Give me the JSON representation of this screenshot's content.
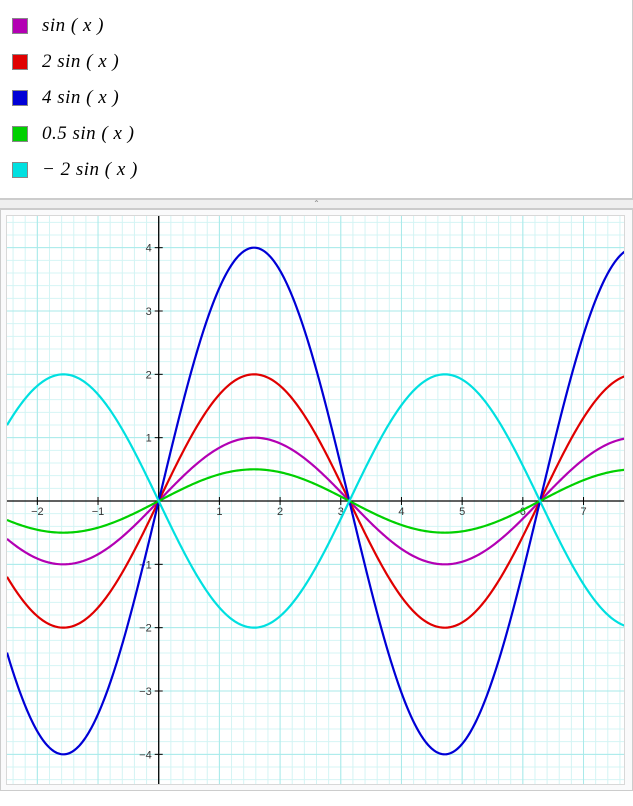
{
  "legend": {
    "items": [
      {
        "color": "#b300b3",
        "label": "sin ( x )"
      },
      {
        "color": "#e00000",
        "label": "2 sin ( x )"
      },
      {
        "color": "#0000d6",
        "label": "4 sin ( x )"
      },
      {
        "color": "#00d000",
        "label": "0.5 sin ( x )"
      },
      {
        "color": "#00e0e0",
        "label": "− 2 sin ( x )"
      }
    ]
  },
  "chart_data": {
    "type": "line",
    "xlabel": "",
    "ylabel": "",
    "title": "",
    "xlim": [
      -2.5,
      7.7
    ],
    "ylim": [
      -4.5,
      4.5
    ],
    "x_ticks": [
      -2,
      -1,
      1,
      2,
      3,
      4,
      5,
      6,
      7
    ],
    "y_ticks": [
      -4,
      -3,
      -2,
      -1,
      1,
      2,
      3,
      4
    ],
    "grid_minor": 0.2,
    "grid_major": 1,
    "series": [
      {
        "name": "sin(x)",
        "color": "#b300b3",
        "amplitude": 1,
        "fn": "sin"
      },
      {
        "name": "2 sin(x)",
        "color": "#e00000",
        "amplitude": 2,
        "fn": "sin"
      },
      {
        "name": "4 sin(x)",
        "color": "#0000d6",
        "amplitude": 4,
        "fn": "sin"
      },
      {
        "name": "0.5 sin(x)",
        "color": "#00d000",
        "amplitude": 0.5,
        "fn": "sin"
      },
      {
        "name": "-2 sin(x)",
        "color": "#00e0e0",
        "amplitude": -2,
        "fn": "sin"
      }
    ],
    "sample_points": {
      "x": [
        -2.5,
        -2,
        -1.5708,
        -1,
        0,
        1,
        1.5708,
        2,
        3,
        3.1416,
        4,
        4.7124,
        5,
        6,
        6.2832,
        7,
        7.7
      ],
      "sin(x)": [
        -0.5985,
        -0.9093,
        -1,
        -0.8415,
        0,
        0.8415,
        1,
        0.9093,
        0.1411,
        0,
        -0.7568,
        -1,
        -0.9589,
        -0.2794,
        0,
        0.657,
        0.9883
      ],
      "2 sin(x)": [
        -1.197,
        -1.8186,
        -2,
        -1.683,
        0,
        1.683,
        2,
        1.8186,
        0.2822,
        0,
        -1.5136,
        -2,
        -1.9178,
        -0.5588,
        0,
        1.314,
        1.9766
      ],
      "4 sin(x)": [
        -2.394,
        -3.6372,
        -4,
        -3.366,
        0,
        3.366,
        4,
        3.6372,
        0.5644,
        0,
        -3.0272,
        -4,
        -3.8356,
        -1.1176,
        0,
        2.628,
        3.9532
      ],
      "0.5 sin(x)": [
        -0.2992,
        -0.4546,
        -0.5,
        -0.4208,
        0,
        0.4208,
        0.5,
        0.4546,
        0.0706,
        0,
        -0.3784,
        -0.5,
        -0.4795,
        -0.1397,
        0,
        0.3285,
        0.4942
      ],
      "-2 sin(x)": [
        1.197,
        1.8186,
        2,
        1.683,
        0,
        -1.683,
        -2,
        -1.8186,
        -0.2822,
        0,
        1.5136,
        2,
        1.9178,
        0.5588,
        0,
        -1.314,
        -1.9766
      ]
    }
  }
}
